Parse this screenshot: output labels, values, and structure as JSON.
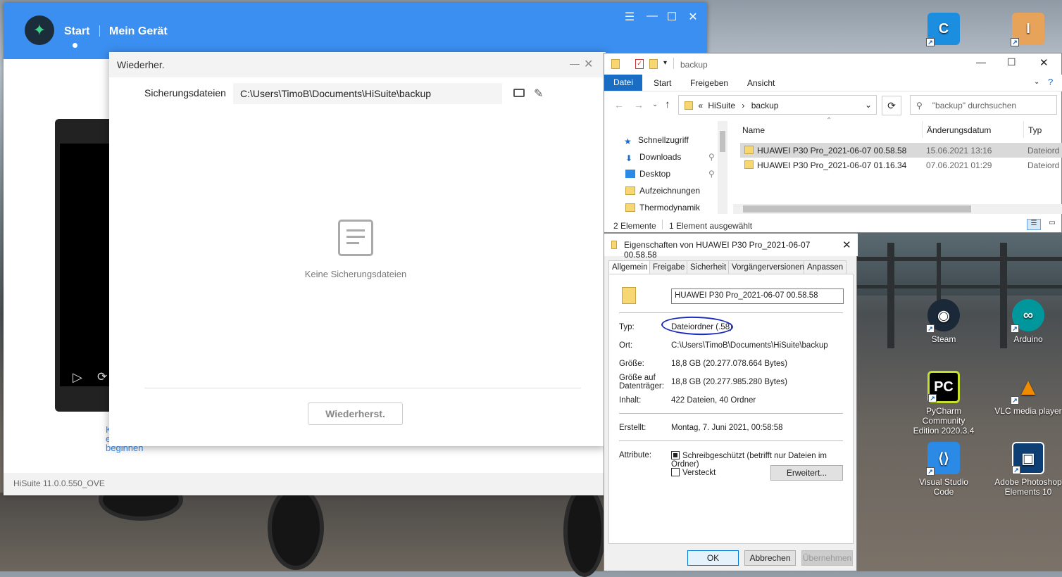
{
  "hisuite": {
    "nav_start": "Start",
    "nav_mygerat": "Mein Gerät",
    "version": "HiSuite 11.0.0.550_OVE",
    "hint_line1": "K",
    "hint_line2": "e",
    "hint_line3": "beginnen"
  },
  "restore": {
    "title": "Wiederher.",
    "path_label": "Sicherungsdateien",
    "path_value": "C:\\Users\\TimoB\\Documents\\HiSuite\\backup",
    "empty_text": "Keine Sicherungsdateien",
    "button": "Wiederherst."
  },
  "explorer": {
    "title": "backup",
    "tabs": [
      "Datei",
      "Start",
      "Freigeben",
      "Ansicht"
    ],
    "breadcrumb": [
      "HiSuite",
      "backup"
    ],
    "search_placeholder": "\"backup\" durchsuchen",
    "nav": [
      "Schnellzugriff",
      "Downloads",
      "Desktop",
      "Aufzeichnungen",
      "Thermodynamik"
    ],
    "columns": [
      "Name",
      "Änderungsdatum",
      "Typ"
    ],
    "rows": [
      {
        "name": "HUAWEI P30 Pro_2021-06-07 00.58.58",
        "date": "15.06.2021 13:16",
        "type": "Dateiord"
      },
      {
        "name": "HUAWEI P30 Pro_2021-06-07 01.16.34",
        "date": "07.06.2021 01:29",
        "type": "Dateiord"
      }
    ],
    "status_count": "2 Elemente",
    "status_selected": "1 Element ausgewählt"
  },
  "properties": {
    "title": "Eigenschaften von HUAWEI P30 Pro_2021-06-07 00.58.58",
    "tabs": [
      "Allgemein",
      "Freigabe",
      "Sicherheit",
      "Vorgängerversionen",
      "Anpassen"
    ],
    "name_value": "HUAWEI P30 Pro_2021-06-07 00.58.58",
    "typ_label": "Typ:",
    "typ_value": "Dateiordner (.58)",
    "ort_label": "Ort:",
    "ort_value": "C:\\Users\\TimoB\\Documents\\HiSuite\\backup",
    "groesse_label": "Größe:",
    "groesse_value": "18,8 GB (20.277.078.664 Bytes)",
    "groesse_auf_label_1": "Größe auf",
    "groesse_auf_label_2": "Datenträger:",
    "groesse_auf_value": "18,8 GB (20.277.985.280 Bytes)",
    "inhalt_label": "Inhalt:",
    "inhalt_value": "422 Dateien, 40 Ordner",
    "erstellt_label": "Erstellt:",
    "erstellt_value": "Montag, 7. Juni 2021, 00:58:58",
    "attribute_label": "Attribute:",
    "readonly_label": "Schreibgeschützt (betrifft nur Dateien im Ordner)",
    "hidden_label": "Versteckt",
    "advanced_button": "Erweitert...",
    "ok": "OK",
    "cancel": "Abbrechen",
    "apply": "Übernehmen"
  },
  "desktop_icons": {
    "steam": "Steam",
    "arduino": "Arduino",
    "pycharm_1": "PyCharm Community",
    "pycharm_2": "Edition 2020.3.4",
    "vlc": "VLC media player",
    "vscode": "Visual Studio Code",
    "photoshop_1": "Adobe Photoshop",
    "photoshop_2": "Elements 10"
  },
  "colors": {
    "hisuite_blue": "#3b8ff0",
    "explorer_accent": "#1a6dc5",
    "annotation": "#1a2bb8"
  }
}
